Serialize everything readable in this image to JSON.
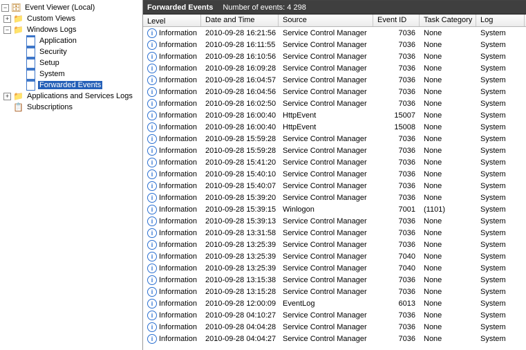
{
  "tree": {
    "root": "Event Viewer (Local)",
    "nodes": [
      {
        "label": "Custom Views",
        "icon": "folder",
        "depth": 1,
        "exp": "+"
      },
      {
        "label": "Windows Logs",
        "icon": "folder",
        "depth": 1,
        "exp": "-"
      },
      {
        "label": "Application",
        "icon": "log",
        "depth": 2,
        "exp": ""
      },
      {
        "label": "Security",
        "icon": "log",
        "depth": 2,
        "exp": ""
      },
      {
        "label": "Setup",
        "icon": "log",
        "depth": 2,
        "exp": ""
      },
      {
        "label": "System",
        "icon": "log",
        "depth": 2,
        "exp": ""
      },
      {
        "label": "Forwarded Events",
        "icon": "log",
        "depth": 2,
        "exp": "",
        "selected": true
      },
      {
        "label": "Applications and Services Logs",
        "icon": "folder",
        "depth": 1,
        "exp": "+"
      },
      {
        "label": "Subscriptions",
        "icon": "sub",
        "depth": 1,
        "exp": ""
      }
    ]
  },
  "header": {
    "title": "Forwarded Events",
    "count_label": "Number of events: 4 298"
  },
  "columns": {
    "level": "Level",
    "date": "Date and Time",
    "source": "Source",
    "eventid": "Event ID",
    "task": "Task Category",
    "log": "Log"
  },
  "level_text": "Information",
  "events": [
    {
      "date": "2010-09-28 16:21:56",
      "source": "Service Control Manager",
      "id": "7036",
      "task": "None",
      "log": "System"
    },
    {
      "date": "2010-09-28 16:11:55",
      "source": "Service Control Manager",
      "id": "7036",
      "task": "None",
      "log": "System"
    },
    {
      "date": "2010-09-28 16:10:56",
      "source": "Service Control Manager",
      "id": "7036",
      "task": "None",
      "log": "System"
    },
    {
      "date": "2010-09-28 16:09:28",
      "source": "Service Control Manager",
      "id": "7036",
      "task": "None",
      "log": "System"
    },
    {
      "date": "2010-09-28 16:04:57",
      "source": "Service Control Manager",
      "id": "7036",
      "task": "None",
      "log": "System"
    },
    {
      "date": "2010-09-28 16:04:56",
      "source": "Service Control Manager",
      "id": "7036",
      "task": "None",
      "log": "System"
    },
    {
      "date": "2010-09-28 16:02:50",
      "source": "Service Control Manager",
      "id": "7036",
      "task": "None",
      "log": "System"
    },
    {
      "date": "2010-09-28 16:00:40",
      "source": "HttpEvent",
      "id": "15007",
      "task": "None",
      "log": "System"
    },
    {
      "date": "2010-09-28 16:00:40",
      "source": "HttpEvent",
      "id": "15008",
      "task": "None",
      "log": "System"
    },
    {
      "date": "2010-09-28 15:59:28",
      "source": "Service Control Manager",
      "id": "7036",
      "task": "None",
      "log": "System"
    },
    {
      "date": "2010-09-28 15:59:28",
      "source": "Service Control Manager",
      "id": "7036",
      "task": "None",
      "log": "System"
    },
    {
      "date": "2010-09-28 15:41:20",
      "source": "Service Control Manager",
      "id": "7036",
      "task": "None",
      "log": "System"
    },
    {
      "date": "2010-09-28 15:40:10",
      "source": "Service Control Manager",
      "id": "7036",
      "task": "None",
      "log": "System"
    },
    {
      "date": "2010-09-28 15:40:07",
      "source": "Service Control Manager",
      "id": "7036",
      "task": "None",
      "log": "System"
    },
    {
      "date": "2010-09-28 15:39:20",
      "source": "Service Control Manager",
      "id": "7036",
      "task": "None",
      "log": "System"
    },
    {
      "date": "2010-09-28 15:39:15",
      "source": "Winlogon",
      "id": "7001",
      "task": "(1101)",
      "log": "System"
    },
    {
      "date": "2010-09-28 15:39:13",
      "source": "Service Control Manager",
      "id": "7036",
      "task": "None",
      "log": "System"
    },
    {
      "date": "2010-09-28 13:31:58",
      "source": "Service Control Manager",
      "id": "7036",
      "task": "None",
      "log": "System"
    },
    {
      "date": "2010-09-28 13:25:39",
      "source": "Service Control Manager",
      "id": "7036",
      "task": "None",
      "log": "System"
    },
    {
      "date": "2010-09-28 13:25:39",
      "source": "Service Control Manager",
      "id": "7040",
      "task": "None",
      "log": "System"
    },
    {
      "date": "2010-09-28 13:25:39",
      "source": "Service Control Manager",
      "id": "7040",
      "task": "None",
      "log": "System"
    },
    {
      "date": "2010-09-28 13:15:38",
      "source": "Service Control Manager",
      "id": "7036",
      "task": "None",
      "log": "System"
    },
    {
      "date": "2010-09-28 13:15:28",
      "source": "Service Control Manager",
      "id": "7036",
      "task": "None",
      "log": "System"
    },
    {
      "date": "2010-09-28 12:00:09",
      "source": "EventLog",
      "id": "6013",
      "task": "None",
      "log": "System"
    },
    {
      "date": "2010-09-28 04:10:27",
      "source": "Service Control Manager",
      "id": "7036",
      "task": "None",
      "log": "System"
    },
    {
      "date": "2010-09-28 04:04:28",
      "source": "Service Control Manager",
      "id": "7036",
      "task": "None",
      "log": "System"
    },
    {
      "date": "2010-09-28 04:04:27",
      "source": "Service Control Manager",
      "id": "7036",
      "task": "None",
      "log": "System"
    }
  ]
}
